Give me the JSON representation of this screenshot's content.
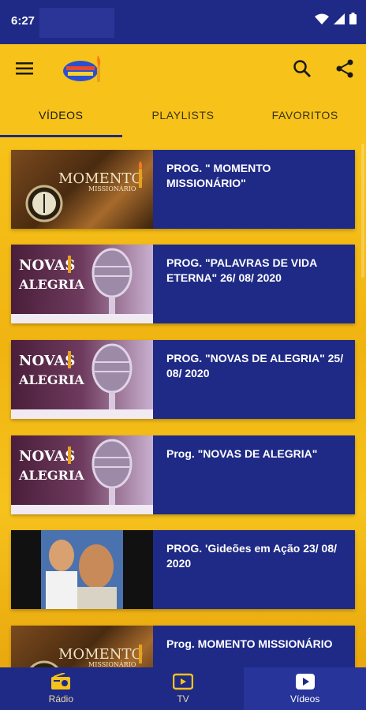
{
  "status": {
    "time": "6:27"
  },
  "appbar": {
    "menu_icon": "hamburger-icon",
    "logo": "app-logo",
    "search_icon": "search-icon",
    "share_icon": "share-icon"
  },
  "tabs": [
    {
      "label": "VÍDEOS",
      "active": true
    },
    {
      "label": "PLAYLISTS",
      "active": false
    },
    {
      "label": "FAVORITOS",
      "active": false
    }
  ],
  "videos": [
    {
      "title": "PROG. \" MOMENTO MISSIONÁRIO\"",
      "thumb": "momento",
      "thumb_text": "MOMENTO",
      "thumb_sub": "MISSIONÁRIO"
    },
    {
      "title": "PROG. \"PALAVRAS DE VIDA ETERNA\"   26/ 08/ 2020",
      "thumb": "novas",
      "thumb_text": "NOVAS",
      "thumb_sub": "ALEGRIA"
    },
    {
      "title": "PROG. \"NOVAS DE ALEGRIA\" 25/ 08/ 2020",
      "thumb": "novas",
      "thumb_text": "NOVAS",
      "thumb_sub": "ALEGRIA"
    },
    {
      "title": "Prog. \"NOVAS DE ALEGRIA\"",
      "thumb": "novas",
      "thumb_text": "NOVAS",
      "thumb_sub": "ALEGRIA"
    },
    {
      "title": "PROG. 'Gideões em Ação 23/ 08/ 2020",
      "thumb": "gideoes",
      "thumb_text": "",
      "thumb_sub": ""
    },
    {
      "title": "Prog. MOMENTO MISSIONÁRIO",
      "thumb": "momento",
      "thumb_text": "MOMENTO",
      "thumb_sub": "MISSIONÁRIO"
    }
  ],
  "bottom_nav": [
    {
      "label": "Rádio",
      "icon": "radio-icon",
      "active": false
    },
    {
      "label": "TV",
      "icon": "tv-icon",
      "active": false
    },
    {
      "label": "Vídeos",
      "icon": "play-video-icon",
      "active": true
    }
  ],
  "colors": {
    "primary": "#1f2a86",
    "accent": "#f7c21a"
  }
}
